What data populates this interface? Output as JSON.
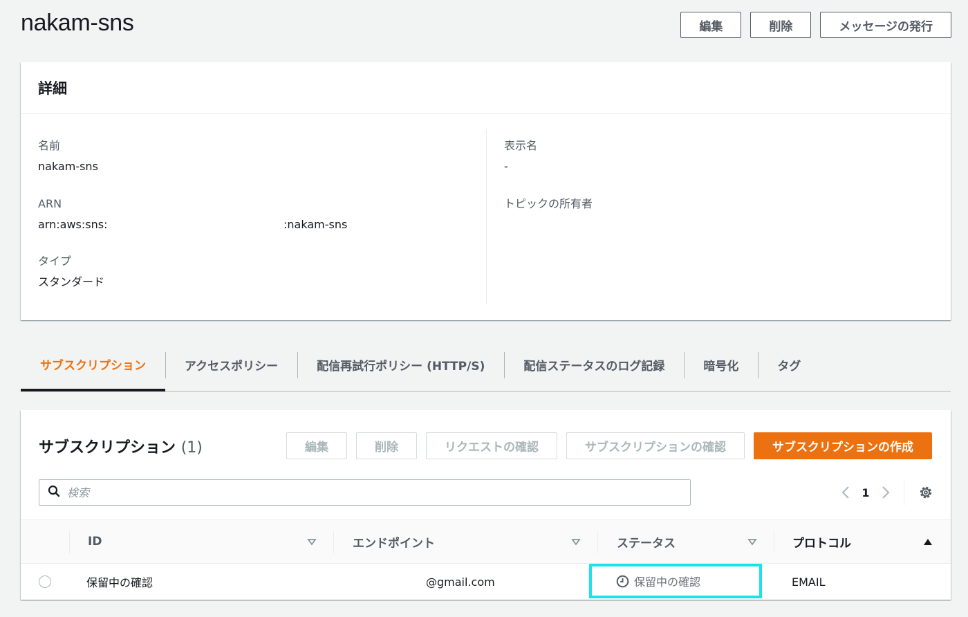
{
  "page": {
    "title": "nakam-sns",
    "actions": {
      "edit": "編集",
      "delete": "削除",
      "publish": "メッセージの発行"
    }
  },
  "details": {
    "header": "詳細",
    "name_label": "名前",
    "name_value": "nakam-sns",
    "arn_label": "ARN",
    "arn_prefix": "arn:aws:sns:",
    "arn_suffix": ":nakam-sns",
    "type_label": "タイプ",
    "type_value": "スタンダード",
    "display_name_label": "表示名",
    "display_name_value": "-",
    "owner_label": "トピックの所有者",
    "owner_value": ""
  },
  "tabs": [
    {
      "label": "サブスクリプション",
      "active": true
    },
    {
      "label": "アクセスポリシー",
      "active": false
    },
    {
      "label": "配信再試行ポリシー (HTTP/S)",
      "active": false
    },
    {
      "label": "配信ステータスのログ記録",
      "active": false
    },
    {
      "label": "暗号化",
      "active": false
    },
    {
      "label": "タグ",
      "active": false
    }
  ],
  "subscriptions": {
    "title": "サブスクリプション",
    "count": "(1)",
    "actions": {
      "edit": "編集",
      "delete": "削除",
      "confirm_request": "リクエストの確認",
      "confirm_subscription": "サブスクリプションの確認",
      "create": "サブスクリプションの作成"
    },
    "search_placeholder": "検索",
    "page": "1",
    "columns": {
      "id": "ID",
      "endpoint": "エンドポイント",
      "status": "ステータス",
      "protocol": "プロトコル"
    },
    "rows": [
      {
        "id": "保留中の確認",
        "endpoint": "@gmail.com",
        "status": "保留中の確認",
        "protocol": "EMAIL"
      }
    ]
  },
  "colors": {
    "accent": "#ec7211",
    "highlight": "#1de2ea",
    "text": "#16191f",
    "muted": "#545b64"
  }
}
